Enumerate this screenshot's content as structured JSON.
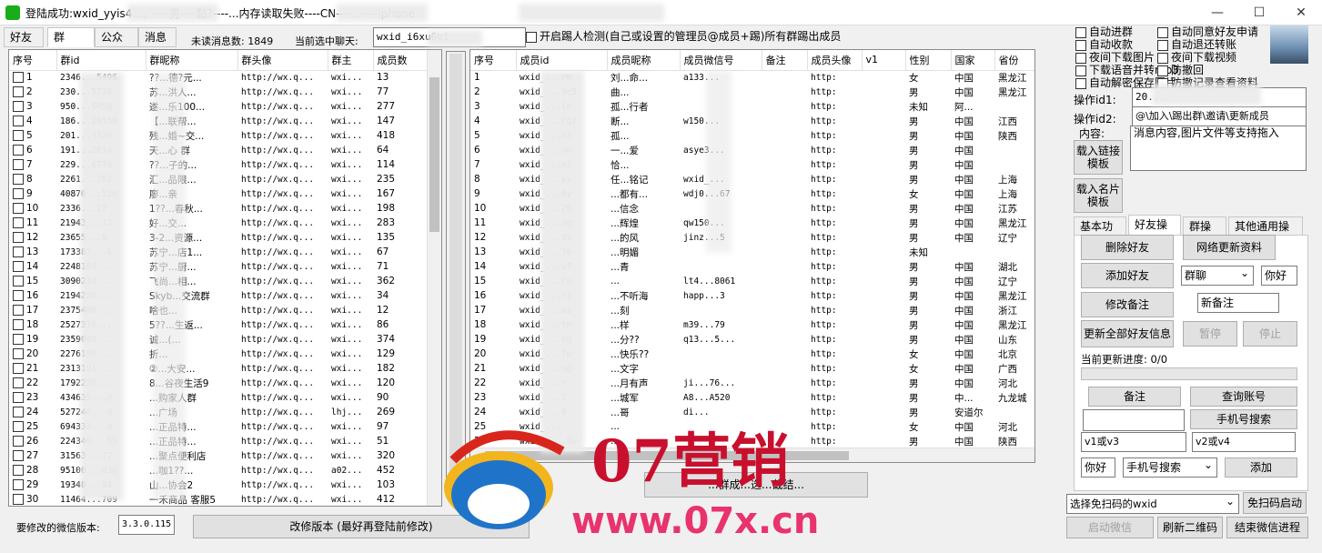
{
  "window": {
    "title": "登陆成功:wxid_yyis4...。----男----黏?----...内存读取失败----CN----...----iphone",
    "minimize": "—",
    "maximize": "☐",
    "close": "✕"
  },
  "tabs": [
    "好友",
    "群",
    "公众号",
    "消息"
  ],
  "header": {
    "unread_label": "未读消息数: 1849",
    "current_chat_label": "当前选中聊天:",
    "current_chat_value": "wxid_i6xu6vi",
    "kick_checkbox": "开启踢人检测(自己或设置的管理员@成员+踢)所有群踢出成员"
  },
  "group_table": {
    "columns": [
      "序号",
      "群id",
      "群昵称",
      "群头像",
      "群主",
      "成员数"
    ],
    "rows": [
      [
        "1",
        "2346...5496",
        "??...德?元...",
        "http://wx.q...",
        "wxi...",
        "13"
      ],
      [
        "2",
        "230...5716",
        "苏...洪人...",
        "http://wx.q...",
        "wxi...",
        "77"
      ],
      [
        "3",
        "950...505@",
        "遂...乐100...",
        "http://wx.q...",
        "wxi...",
        "277"
      ],
      [
        "4",
        "186...20550",
        "【...联帮...",
        "http://wx.q...",
        "wxi...",
        "147"
      ],
      [
        "5",
        "201...3329",
        "残...婚~交...",
        "http://wx.q...",
        "wxi...",
        "418"
      ],
      [
        "6",
        "191...2614",
        "天...心  群",
        "http://wx.q...",
        "wxi...",
        "64"
      ],
      [
        "7",
        "229...6779",
        "??...子的...",
        "http://wx.q...",
        "wxi...",
        "114"
      ],
      [
        "8",
        "2261...702",
        "汇...品限...",
        "http://wx.q...",
        "wxi...",
        "235"
      ],
      [
        "9",
        "40870...52@",
        "廖...亲",
        "http://wx.q...",
        "wxi...",
        "167"
      ],
      [
        "10",
        "2336...17",
        "1??...春秋...",
        "http://wx.q...",
        "wxi...",
        "198"
      ],
      [
        "11",
        "21943...12",
        "好...交...",
        "http://wx.q...",
        "wxi...",
        "283"
      ],
      [
        "12",
        "23655...9",
        "3-2...资源...",
        "http://wx.q...",
        "wxi...",
        "135"
      ],
      [
        "13",
        "173382...6",
        "苏宁...店1...",
        "http://wx.q...",
        "wxi...",
        "67"
      ],
      [
        "14",
        "2248184...",
        "苏宁...厨...",
        "http://wx.q...",
        "wxi...",
        "71"
      ],
      [
        "15",
        "3090234...",
        "飞尚...相...",
        "http://wx.q...",
        "wxi...",
        "362"
      ],
      [
        "16",
        "2194220...",
        "Skyb...交流群",
        "http://wx.q...",
        "wxi...",
        "34"
      ],
      [
        "17",
        "2375406...",
        "啥也...",
        "http://wx.q...",
        "wxi...",
        "12"
      ],
      [
        "18",
        "2527336...",
        "5??...生返...",
        "http://wx.q...",
        "wxi...",
        "86"
      ],
      [
        "19",
        "2359088...",
        "诚...(...",
        "http://wx.q...",
        "wxi...",
        "374"
      ],
      [
        "20",
        "2276150...",
        "折...",
        "http://wx.q...",
        "wxi...",
        "129"
      ],
      [
        "21",
        "2313191...",
        "②...大安...",
        "http://wx.q...",
        "wxi...",
        "182"
      ],
      [
        "22",
        "1792220...",
        "8...谷夜生活9",
        "http://wx.q...",
        "wxi...",
        "120"
      ],
      [
        "23",
        "434639...@",
        "...购家人群",
        "http://wx.q...",
        "wxi...",
        "90"
      ],
      [
        "24",
        "527246...@",
        "...广场",
        "http://wx.q...",
        "lhj...",
        "269"
      ],
      [
        "25",
        "694333...@",
        "...正品特...",
        "http://wx.q...",
        "wxi...",
        "97"
      ],
      [
        "26",
        "224340...55",
        "...正品特...",
        "http://wx.q...",
        "wxi...",
        "51"
      ],
      [
        "27",
        "31563...72",
        "...聚点便利店",
        "http://wx.q...",
        "wxi...",
        "320"
      ],
      [
        "28",
        "95100...03@",
        "...咖1??...",
        "http://wx.q...",
        "a02...",
        "452"
      ],
      [
        "29",
        "19348...94",
        "山...协会2",
        "http://wx.q...",
        "wxi...",
        "103"
      ],
      [
        "30",
        "11464...709",
        "一禾商品 客服5",
        "http://wx.q...",
        "wxi...",
        "412"
      ]
    ]
  },
  "member_table": {
    "columns": [
      "序号",
      "成员id",
      "成员昵称",
      "成员微信号",
      "备注",
      "成员头像",
      "v1",
      "性别",
      "国家",
      "省份"
    ],
    "rows": [
      [
        "1",
        "wxid_...rm",
        "刘...命...",
        "a133...",
        "",
        "http:",
        "",
        "女",
        "中国",
        "黑龙江"
      ],
      [
        "2",
        "wxid_...9e5",
        "曲...",
        "",
        "",
        "http:",
        "",
        "男",
        "中国",
        "黑龙江"
      ],
      [
        "3",
        "wxid_...le",
        "孤...行者",
        "",
        "",
        "http:",
        "",
        "未知",
        "阿...",
        ""
      ],
      [
        "4",
        "wxid_...rg2",
        "断...",
        "w150...",
        "",
        "http:",
        "",
        "男",
        "中国",
        "江西"
      ],
      [
        "5",
        "wxid_...ni",
        "孤...",
        "",
        "",
        "http:",
        "",
        "男",
        "中国",
        "陕西"
      ],
      [
        "6",
        "wxid_...ww",
        "一...爱",
        "asye3...",
        "",
        "http:",
        "",
        "男",
        "中国",
        ""
      ],
      [
        "7",
        "wxid_...n1",
        "恰...",
        "",
        "",
        "http:",
        "",
        "男",
        "中国",
        ""
      ],
      [
        "8",
        "wxid_...sx",
        "任...铭记",
        "wxid_...",
        "",
        "http:",
        "",
        "男",
        "中国",
        "上海"
      ],
      [
        "9",
        "wxid_...4y",
        "...都有...",
        "wdj0...67",
        "",
        "http:",
        "",
        "女",
        "中国",
        "上海"
      ],
      [
        "10",
        "wxid_...26",
        "...信念",
        "",
        "",
        "http:",
        "",
        "男",
        "中国",
        "江苏"
      ],
      [
        "11",
        "wxid_...ag",
        "...辉煌",
        "qw150...",
        "",
        "http:",
        "",
        "男",
        "中国",
        "黑龙江"
      ],
      [
        "12",
        "wxid_...95",
        "...的风",
        "jinz...5",
        "",
        "http:",
        "",
        "男",
        "中国",
        "辽宁"
      ],
      [
        "13",
        "wxid_...3b",
        "...明媚",
        "",
        "",
        "http:",
        "",
        "未知",
        "",
        ""
      ],
      [
        "14",
        "wxid_...u7",
        "...青",
        "",
        "",
        "http:",
        "",
        "男",
        "中国",
        "湖北"
      ],
      [
        "15",
        "wxid_...re",
        "...",
        "lt4...8061",
        "",
        "http:",
        "",
        "男",
        "中国",
        "辽宁"
      ],
      [
        "16",
        "wxid_...r1",
        "...不听海",
        "happ...3",
        "",
        "http:",
        "",
        "男",
        "中国",
        "黑龙江"
      ],
      [
        "17",
        "wxid_...az",
        "...刻",
        "",
        "",
        "http:",
        "",
        "男",
        "中国",
        "浙江"
      ],
      [
        "18",
        "wxid_...tn",
        "...样",
        "m39...79",
        "",
        "http:",
        "",
        "男",
        "中国",
        "黑龙江"
      ],
      [
        "19",
        "wxid_...oq",
        "...分??",
        "q13...5...",
        "",
        "http:",
        "",
        "男",
        "中国",
        "山东"
      ],
      [
        "20",
        "wxid_...fu",
        "...快乐??",
        "",
        "",
        "http:",
        "",
        "女",
        "中国",
        "北京"
      ],
      [
        "21",
        "wxid_...ug",
        "...文字",
        "",
        "",
        "http:",
        "",
        "女",
        "中国",
        "广西"
      ],
      [
        "22",
        "wxid_...r",
        "...月有声",
        "ji...76...",
        "",
        "http:",
        "",
        "男",
        "中国",
        "河北"
      ],
      [
        "23",
        "wxid_...t",
        "...城军",
        "A8...A520",
        "",
        "http:",
        "",
        "男",
        "中...",
        "九龙城"
      ],
      [
        "24",
        "wxid_...8",
        "...哥",
        "di...",
        "",
        "http:",
        "",
        "男",
        "安道尔",
        ""
      ],
      [
        "25",
        "wxid_...",
        "...",
        "",
        "",
        "http:",
        "",
        "女",
        "中国",
        "河北"
      ],
      [
        "26",
        "wxid_x...9w",
        "...",
        "",
        "",
        "http:",
        "",
        "男",
        "中国",
        "陕西"
      ]
    ]
  },
  "bottom": {
    "version_label": "要修改的微信版本:",
    "version_value": "3.3.0.115",
    "modify_button": "改修版本 (最好再登陆前修改)",
    "middle_button": "...群成...选...截结..."
  },
  "right_panel": {
    "checkboxes_left": [
      "自动进群",
      "自动收款",
      "夜间下载图片",
      "下载语音并转mp3",
      "自动解密保存图片"
    ],
    "checkboxes_right": [
      "自动同意好友申请",
      "自动退还转账",
      "夜间下载视频",
      "防撤回",
      "防撤记录查看资料"
    ],
    "op_id1_label": "操作id1:",
    "op_id1_value": "20...",
    "op_id2_label": "操作id2:",
    "op_id2_value": "@\\加入\\踢出群\\邀请\\更新成员",
    "content_label": "内容:",
    "content_value": "消息内容,图片文件等支持拖入",
    "load_link_button": "载入链接模板",
    "load_card_button": "载入名片模板",
    "sub_tabs": [
      "基本功能",
      "好友操作",
      "群操作",
      "其他通用操作"
    ],
    "delete_friend": "删除好友",
    "network_update": "网络更新资料",
    "add_friend": "添加好友",
    "group_chat_select": "群聊",
    "hello_input": "你好",
    "edit_remark": "修改备注",
    "new_remark": "新备注",
    "update_all": "更新全部好友信息",
    "pause": "暂停",
    "stop": "停止",
    "progress_label": "当前更新进度: 0/0",
    "progress": 0,
    "remark_button": "备注",
    "query_account": "查询账号",
    "phone_search_button": "手机号搜索",
    "v1_or_v3": "v1或v3",
    "v2_or_v4": "v2或v4",
    "hello2": "你好",
    "phone_search_select": "手机号搜索",
    "add_button": "添加",
    "qr_select": "选择免扫码的wxid",
    "qr_start": "免扫码启动",
    "start_wechat": "启动微信",
    "refresh_qr": "刷新二维码",
    "end_process": "结束微信进程"
  },
  "watermark": {
    "brand": "07营销",
    "url": "www.07x.cn"
  }
}
